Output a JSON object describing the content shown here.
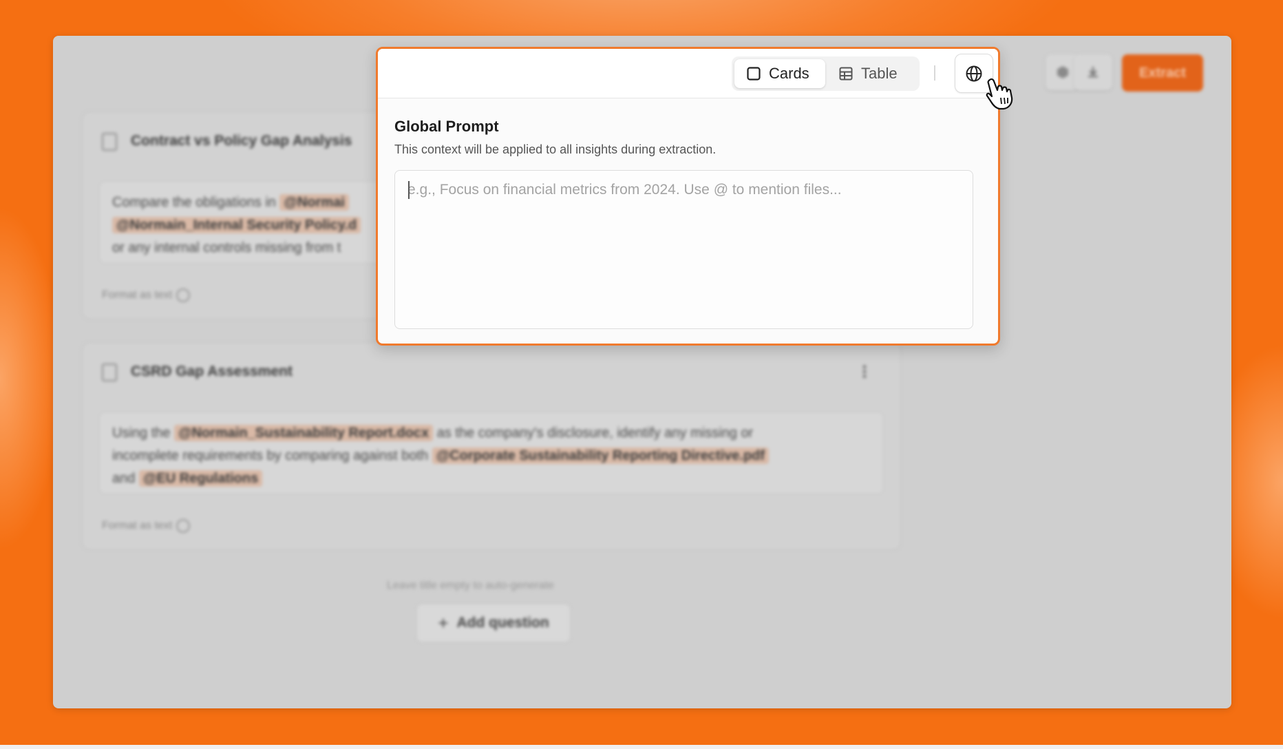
{
  "popover": {
    "view_toggle": {
      "cards_label": "Cards",
      "table_label": "Table",
      "selected": "Cards"
    },
    "title": "Global Prompt",
    "subtitle": "This context will be applied to all insights during extraction.",
    "prompt_placeholder": "e.g., Focus on financial metrics from 2024. Use @ to mention files...",
    "prompt_value": ""
  },
  "background": {
    "extract_label": "Extract",
    "cards": [
      {
        "title": "Contract vs Policy Gap Analysis",
        "body_lines": [
          "Compare the obligations in",
          "@Normai",
          "@Normain_Internal Security Policy.d",
          "or any internal controls missing from t"
        ],
        "format_label": "Format as text"
      },
      {
        "title": "CSRD Gap Assessment",
        "body_parts": {
          "p1": "Using the",
          "m1": "@Normain_Sustainability Report.docx",
          "p2": "as the company's disclosure, identify any missing or",
          "p3": "incomplete requirements by comparing against both",
          "m2": "@Corporate Sustainability Reporting Directive.pdf",
          "p4": "and",
          "m3": "@EU Regulations"
        },
        "format_label": "Format as text"
      }
    ],
    "hint": "Leave title empty to auto-generate",
    "add_question_label": "Add question"
  },
  "colors": {
    "accent": "#f07a2d",
    "backdrop": "#f56f12"
  },
  "icons": [
    "square-icon",
    "table-icon",
    "globe-icon",
    "hand-pointer-cursor",
    "document-icon",
    "download-icon",
    "plus-icon",
    "kebab-icon",
    "gear-icon"
  ]
}
